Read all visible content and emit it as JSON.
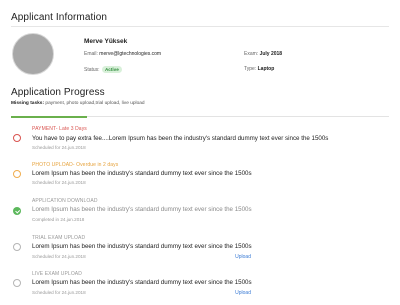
{
  "header": {
    "title": "Applicant Information"
  },
  "applicant": {
    "name": "Merve Yüksek",
    "email_label": "Email:",
    "email": "merve@lgtechnologies.com",
    "status_label": "Status:",
    "status": "Active",
    "exam_label": "Exam:",
    "exam": "July 2018",
    "type_label": "Type:",
    "type": "Laptop"
  },
  "progress": {
    "title": "Application Progress",
    "missing_label": "Missing tasks:",
    "missing_value": " payment, photo upload,trial upload, live upload",
    "completed_fraction": 0.2
  },
  "tasks": [
    {
      "label": "PAYMENT- Late 3 Days",
      "desc": "You have to pay extra fee....Lorem Ipsum has been the industry's standard dummy text ever since the 1500s",
      "date": "Scheduled for 24.jun.2018",
      "state": "late"
    },
    {
      "label": "PHOTO UPLOAD- Overdue in 2 days",
      "desc": "Lorem Ipsum has been the industry's standard dummy text ever since the 1500s",
      "date": "Scheduled for 24.jun.2018",
      "state": "overdue"
    },
    {
      "label": "APPLICATION DOWNLOAD",
      "desc": "Lorem Ipsum has been the industry's standard dummy text ever since the 1500s",
      "date": "Completed in 24.jun.2018",
      "state": "done"
    },
    {
      "label": "TRIAL EXAM UPLOAD",
      "desc": "Lorem Ipsum has been the industry's standard dummy text ever since the 1500s",
      "date": "Scheduled for 24.jun.2018",
      "state": "pending",
      "action": "Upload"
    },
    {
      "label": "LIVE EXAM UPLOAD",
      "desc": "Lorem Ipsum has been the industry's standard dummy text ever since the 1500s",
      "date": "Scheduled for 24.jun.2018",
      "state": "pending",
      "action": "Upload"
    }
  ]
}
